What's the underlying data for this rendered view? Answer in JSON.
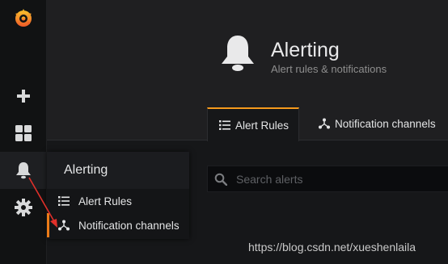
{
  "app": {
    "name": "Grafana"
  },
  "sidebar": {
    "items": [
      {
        "icon": "grafana-logo-icon"
      },
      {
        "icon": "plus-icon"
      },
      {
        "icon": "dashboards-grid-icon"
      },
      {
        "icon": "bell-icon",
        "active": true
      },
      {
        "icon": "gear-icon"
      }
    ]
  },
  "flyout": {
    "title": "Alerting",
    "items": [
      {
        "label": "Alert Rules",
        "icon": "list-icon"
      },
      {
        "label": "Notification channels",
        "icon": "share-nodes-icon"
      }
    ]
  },
  "page": {
    "title": "Alerting",
    "subtitle": "Alert rules & notifications",
    "icon": "bell-icon"
  },
  "tabs": [
    {
      "label": "Alert Rules",
      "icon": "list-icon",
      "active": true
    },
    {
      "label": "Notification channels",
      "icon": "share-nodes-icon"
    }
  ],
  "search": {
    "placeholder": "Search alerts",
    "value": ""
  },
  "watermark": "https://blog.csdn.net/xueshenlaila",
  "colors": {
    "accent": "#eb7b18",
    "arrow": "#e0302a",
    "background": "#161719"
  }
}
